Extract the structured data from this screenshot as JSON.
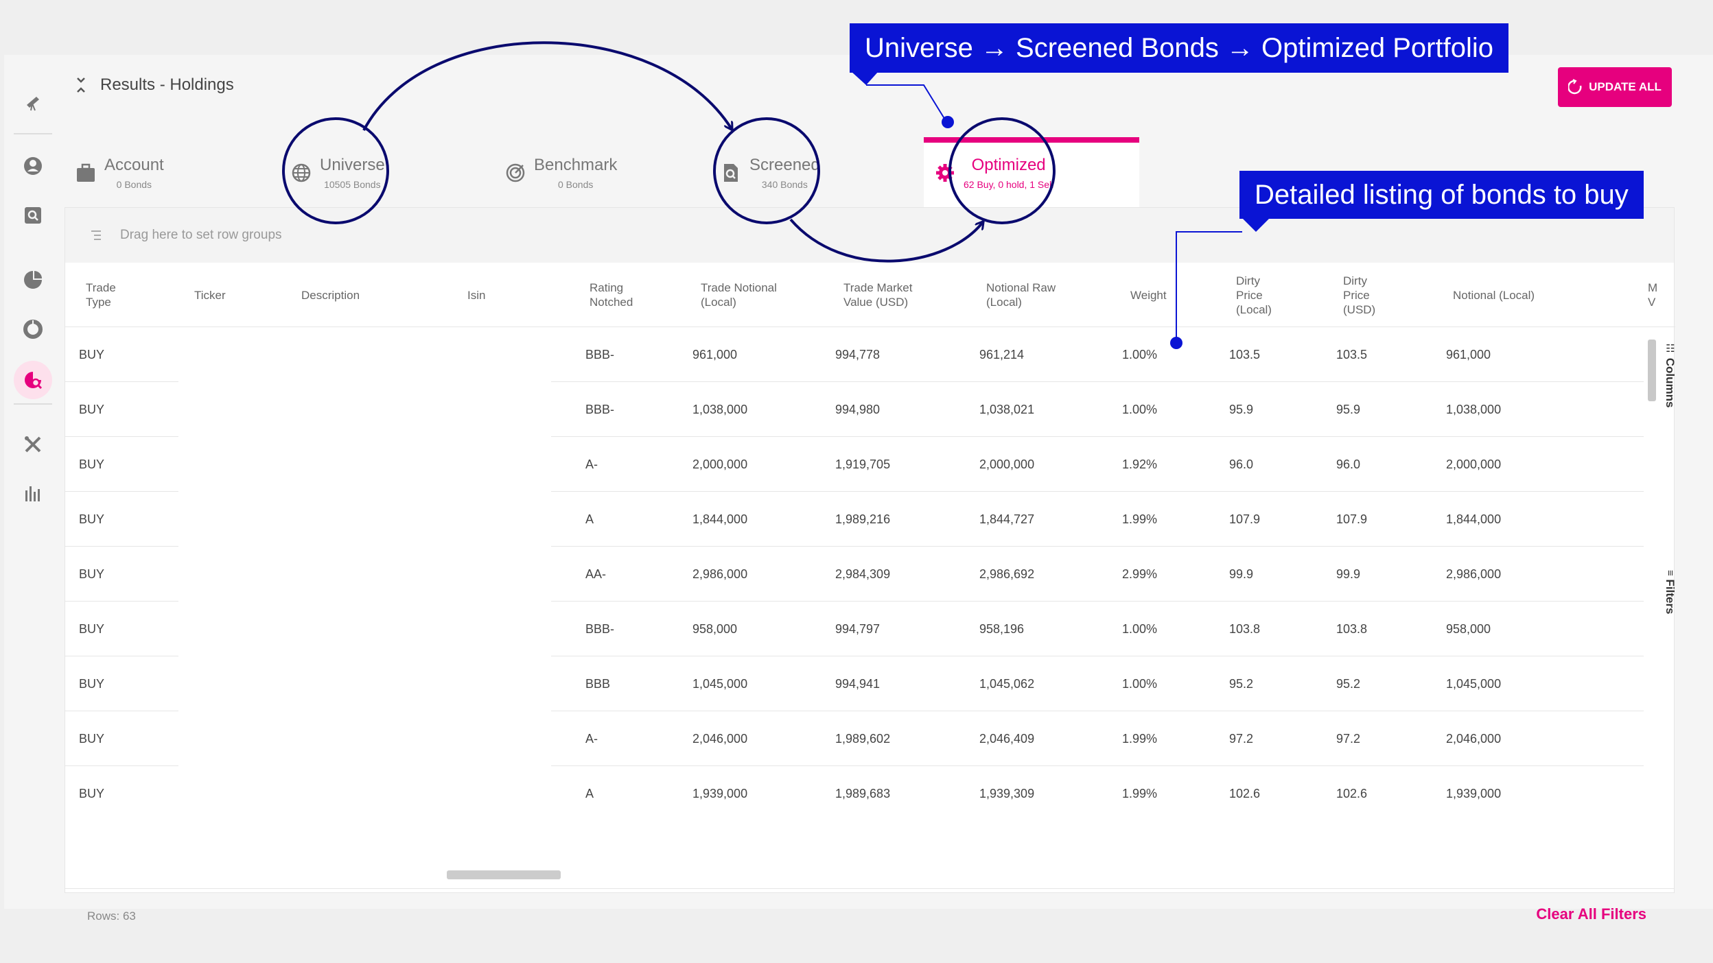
{
  "header": {
    "title": "Results - Holdings",
    "update_label": "UPDATE ALL"
  },
  "tabs": [
    {
      "label": "Account",
      "sub": "0 Bonds",
      "icon": "briefcase-icon"
    },
    {
      "label": "Universe",
      "sub": "10505 Bonds",
      "icon": "globe-icon"
    },
    {
      "label": "Benchmark",
      "sub": "0 Bonds",
      "icon": "target-icon"
    },
    {
      "label": "Screened",
      "sub": "340 Bonds",
      "icon": "screen-doc-icon"
    },
    {
      "label": "Optimized",
      "sub": "62 Buy, 0 hold, 1 Sell",
      "icon": "gear-icon"
    }
  ],
  "grid": {
    "drag_hint": "Drag here to set row groups",
    "columns": [
      {
        "key": "trade_type",
        "label": [
          "Trade",
          "Type"
        ]
      },
      {
        "key": "ticker",
        "label": [
          "Ticker"
        ]
      },
      {
        "key": "description",
        "label": [
          "Description"
        ]
      },
      {
        "key": "isin",
        "label": [
          "Isin"
        ]
      },
      {
        "key": "rating",
        "label": [
          "Rating",
          "Notched"
        ]
      },
      {
        "key": "trade_notional",
        "label": [
          "Trade Notional",
          "(Local)"
        ]
      },
      {
        "key": "trade_mv",
        "label": [
          "Trade Market",
          "Value (USD)"
        ]
      },
      {
        "key": "notional_raw",
        "label": [
          "Notional Raw",
          "(Local)"
        ]
      },
      {
        "key": "weight",
        "label": [
          "Weight"
        ]
      },
      {
        "key": "dirty_local",
        "label": [
          "Dirty",
          "Price",
          "(Local)"
        ]
      },
      {
        "key": "dirty_usd",
        "label": [
          "Dirty",
          "Price",
          "(USD)"
        ]
      },
      {
        "key": "notional_local",
        "label": [
          "Notional (Local)"
        ]
      },
      {
        "key": "mv",
        "label": [
          "M",
          "V"
        ]
      }
    ],
    "rows": [
      [
        "BUY",
        "BBB-",
        "961,000",
        "994,778",
        "961,214",
        "1.00%",
        "103.5",
        "103.5",
        "961,000"
      ],
      [
        "BUY",
        "BBB-",
        "1,038,000",
        "994,980",
        "1,038,021",
        "1.00%",
        "95.9",
        "95.9",
        "1,038,000"
      ],
      [
        "BUY",
        "A-",
        "2,000,000",
        "1,919,705",
        "2,000,000",
        "1.92%",
        "96.0",
        "96.0",
        "2,000,000"
      ],
      [
        "BUY",
        "A",
        "1,844,000",
        "1,989,216",
        "1,844,727",
        "1.99%",
        "107.9",
        "107.9",
        "1,844,000"
      ],
      [
        "BUY",
        "AA-",
        "2,986,000",
        "2,984,309",
        "2,986,692",
        "2.99%",
        "99.9",
        "99.9",
        "2,986,000"
      ],
      [
        "BUY",
        "BBB-",
        "958,000",
        "994,797",
        "958,196",
        "1.00%",
        "103.8",
        "103.8",
        "958,000"
      ],
      [
        "BUY",
        "BBB",
        "1,045,000",
        "994,941",
        "1,045,062",
        "1.00%",
        "95.2",
        "95.2",
        "1,045,000"
      ],
      [
        "BUY",
        "A-",
        "2,046,000",
        "1,989,602",
        "2,046,409",
        "1.99%",
        "97.2",
        "97.2",
        "2,046,000"
      ],
      [
        "BUY",
        "A",
        "1,939,000",
        "1,989,683",
        "1,939,309",
        "1.99%",
        "102.6",
        "102.6",
        "1,939,000"
      ]
    ],
    "side_columns": "Columns",
    "side_filters": "Filters",
    "rows_count": "Rows: 63",
    "clear_filters": "Clear All Filters"
  },
  "callouts": {
    "flow": "Universe → Screened Bonds → Optimized Portfolio",
    "detail": "Detailed listing of bonds to buy"
  },
  "colors": {
    "accent": "#e6007e",
    "callout": "#0a14d4",
    "annotation": "#0a0a6e"
  }
}
